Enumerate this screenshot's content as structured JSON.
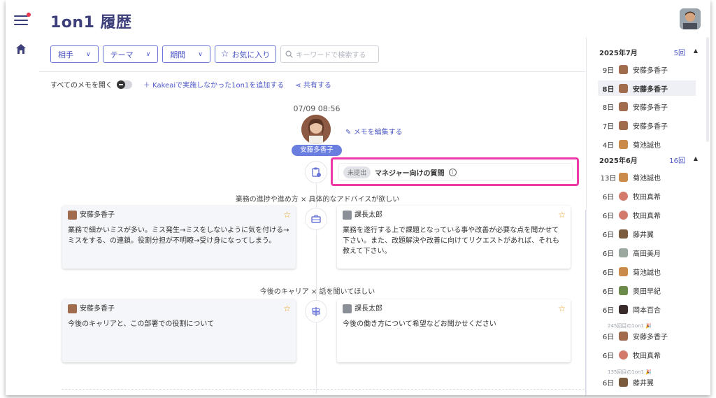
{
  "page": {
    "title": "1on1 履歴"
  },
  "filters": {
    "partner": "相手",
    "theme": "テーマ",
    "period": "期間",
    "favorites": "お気に入り",
    "search_placeholder": "キーワードで検索する"
  },
  "toolbar": {
    "open_all_memos": "すべてのメモを開く",
    "add_outside": "Kakeaiで実施しなかった1on1を追加する",
    "share": "共有する"
  },
  "session": {
    "datetime": "07/09 08:56",
    "member_name": "安藤多香子",
    "edit_memo": "メモを編集する",
    "question_badge": "未提出",
    "question_title": "マネジャー向けの質問",
    "topics": [
      {
        "heading": "業務の進捗や進め方 × 具体的なアドバイスが欲しい",
        "left_author": "安藤多香子",
        "left_text": "業務で細かいミスが多い。ミス発生→ミスをしないように気を付ける→ミスをする、の連鎖。役割分担が不明瞭→受け身になってしまう。",
        "right_author": "課長太郎",
        "right_text": "業務を遂行する上で課題となっている事や改善が必要な点を聞かせて下さい。また、改題解決や改善に向けてリクエストがあれば、それも教えて下さい。"
      },
      {
        "heading": "今後のキャリア × 話を聞いてほしい",
        "left_author": "安藤多香子",
        "left_text": "今後のキャリアと、この部署での役割について",
        "right_author": "課長太郎",
        "right_text": "今後の働き方について希望などお聞かせください"
      }
    ]
  },
  "history": {
    "months": [
      {
        "label": "2025年7月",
        "count": "5回",
        "rows": [
          {
            "day": "9日",
            "name": "安藤多香子",
            "selected": false
          },
          {
            "day": "8日",
            "name": "安藤多香子",
            "selected": true
          },
          {
            "day": "8日",
            "name": "安藤多香子",
            "selected": false
          },
          {
            "day": "7日",
            "name": "安藤多香子",
            "selected": false
          },
          {
            "day": "4日",
            "name": "菊池誠也",
            "selected": false
          }
        ]
      },
      {
        "label": "2025年6月",
        "count": "16回",
        "rows": [
          {
            "day": "13日",
            "name": "菊池誠也"
          },
          {
            "day": "6日",
            "name": "牧田真希"
          },
          {
            "day": "6日",
            "name": "牧田真希"
          },
          {
            "day": "6日",
            "name": "藤井翼"
          },
          {
            "day": "6日",
            "name": "高田美月"
          },
          {
            "day": "6日",
            "name": "菊池誠也"
          },
          {
            "day": "6日",
            "name": "奥田早紀"
          },
          {
            "day": "6日",
            "name": "岡本百合"
          },
          {
            "day": "6日",
            "name": "安藤多香子",
            "sub": "245回目の1on1 🎉"
          },
          {
            "day": "6日",
            "name": "牧田真希"
          },
          {
            "day": "6日",
            "name": "藤井翼",
            "sub": "135回目の1on1 🎉"
          }
        ]
      }
    ]
  },
  "colors": {
    "accent": "#4b55c6",
    "highlight": "#ee3aa8",
    "pill": "#6a7ee0",
    "star": "#f0a020"
  }
}
